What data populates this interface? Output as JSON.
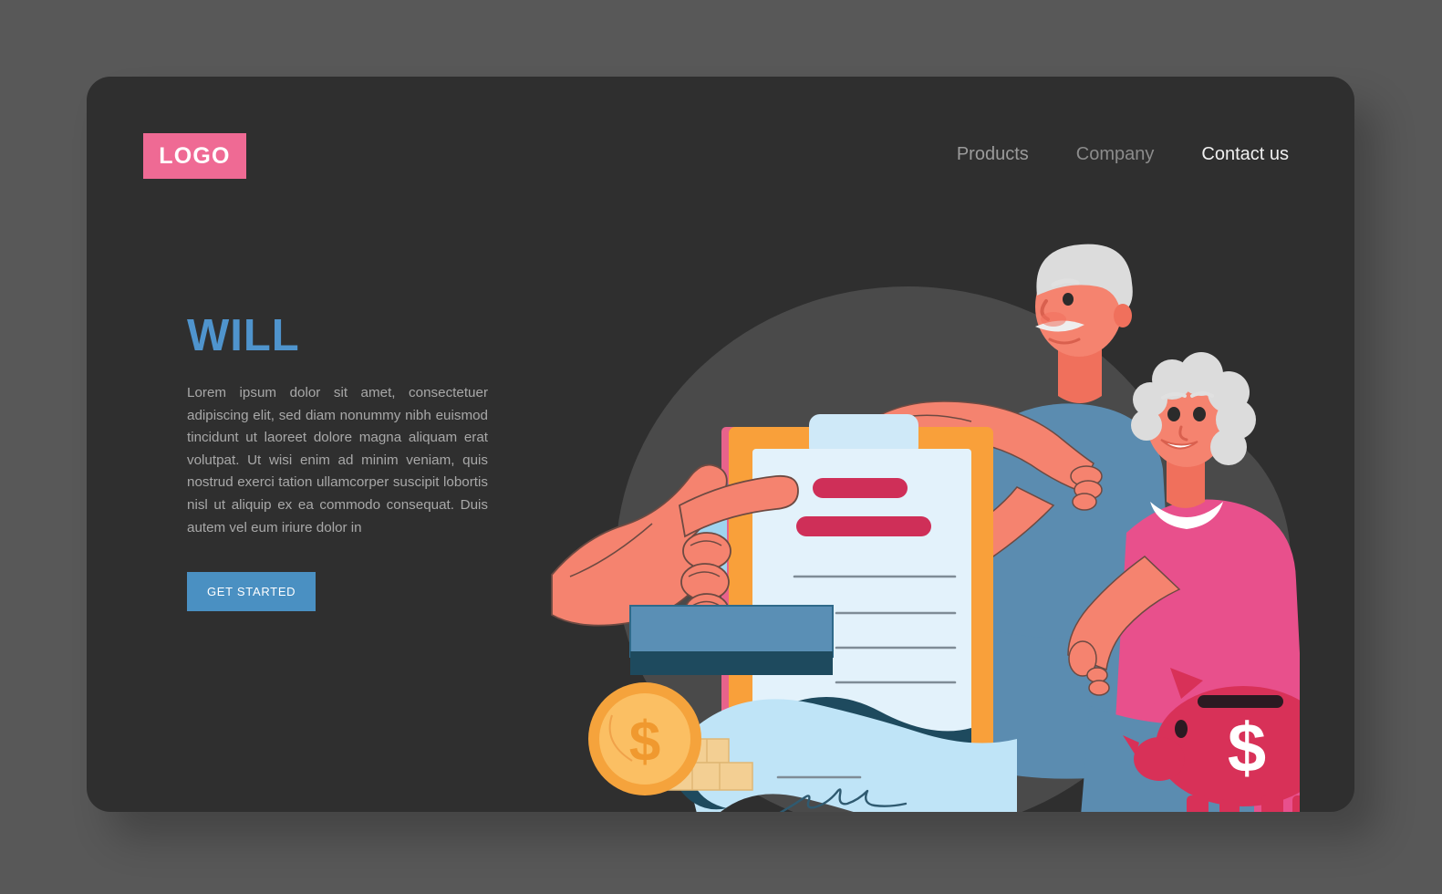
{
  "page": {
    "background_color": "#585858",
    "card_background_color": "#2f2f2f"
  },
  "header": {
    "logo_label": "LOGO",
    "logo_color": "#ef6a94",
    "nav": [
      {
        "label": "Products",
        "state": "normal"
      },
      {
        "label": "Company",
        "state": "dim"
      },
      {
        "label": "Contact us",
        "state": "active"
      }
    ]
  },
  "hero": {
    "title": "WILL",
    "title_color": "#4f94cd",
    "body": "Lorem ipsum dolor sit amet, consectetuer adipiscing elit, sed diam nonummy nibh euismod tincidunt ut laoreet dolore magna aliquam erat volutpat. Ut wisi enim ad minim veniam, quis nostrud exerci tation ullamcorper suscipit lobortis nisl ut aliquip ex ea commodo consequat. Duis autem vel eum iriure dolor in",
    "cta_label": "GET STARTED",
    "cta_color": "#4a90c2"
  },
  "illustration": {
    "name": "will-signing-illustration",
    "description": "Elderly couple beside a clipboard with a will document being stamped, coin, piggy bank and signed scroll",
    "colors": {
      "blob": "#4a4a4a",
      "skin": "#f5836f",
      "skin_shadow": "#f0705c",
      "clipboard_frame": "#f9a03a",
      "clipboard_edge": "#e8638b",
      "paper": "#e3f2fb",
      "paper_line": "#7f8c96",
      "bar": "#cf2f58",
      "stamp": "#5a8fb5",
      "stamp_base": "#1e4a5e",
      "coin": "#f5a33c",
      "coin_light": "#fbbf63",
      "coin_stack": "#f3cf93",
      "piggy": "#d83158",
      "man_shirt": "#5b8cb0",
      "woman_top": "#e8508c",
      "hair": "#dcdcdc",
      "scroll": "#bfe4f7",
      "scroll_fold": "#1e4a5e"
    },
    "elements": [
      "backdrop-blob",
      "secondary-blob",
      "clipboard",
      "will-document",
      "document-heading-bar",
      "document-subheading-bar",
      "document-rule-lines",
      "stamp",
      "stamping-hand",
      "gold-coin",
      "coin-stack",
      "elderly-man",
      "elderly-woman",
      "piggy-bank",
      "signed-scroll",
      "signature"
    ],
    "piggy_symbol": "$",
    "coin_symbol": "$"
  }
}
